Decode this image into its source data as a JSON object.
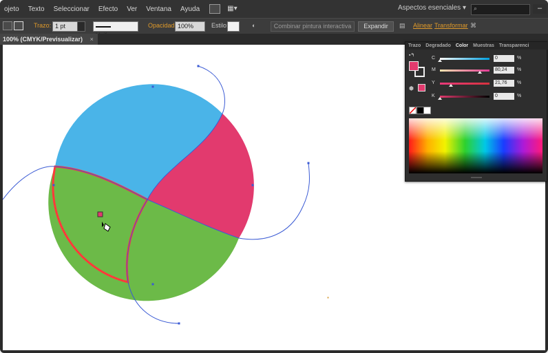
{
  "menubar": {
    "items": [
      "Objeto",
      "Texto",
      "Seleccionar",
      "Efecto",
      "Ver",
      "Ventana",
      "Ayuda"
    ],
    "visible_items": [
      "ojeto",
      "Texto",
      "Seleccionar",
      "Efecto",
      "Ver",
      "Ventana",
      "Ayuda"
    ],
    "arrange_label": "▦▾",
    "workspace": "Aspectos esenciales  ▾",
    "minimize": "–"
  },
  "control": {
    "stroke_label": "Trazo:",
    "stroke_value": "1 pt",
    "profile_label": "Uniforme",
    "opacity_label": "Opacidad:",
    "opacity_value": "100%",
    "style_label": "Estilo:",
    "live_paint_button": "Combinar pintura interactiva",
    "expand_button": "Expandir",
    "align_link": "Alinear",
    "transform_link": "Transformar"
  },
  "document": {
    "tab_title": "100% (CMYK/Previsualizar)",
    "tab_close": "×"
  },
  "color_panel": {
    "tabs": [
      "Trazo",
      "Degradado",
      "Color",
      "Muestras",
      "Transparenci"
    ],
    "active_tab": "Color",
    "channels": [
      {
        "label": "C",
        "value": "0",
        "fraction": 0.0,
        "gradient": [
          "#ffffff",
          "#00a0e0"
        ]
      },
      {
        "label": "M",
        "value": "80,24",
        "fraction": 0.8024,
        "gradient": [
          "#f8e6b0",
          "#e23c96"
        ]
      },
      {
        "label": "Y",
        "value": "21,76",
        "fraction": 0.2176,
        "gradient": [
          "#e83a7a",
          "#d8323e"
        ]
      },
      {
        "label": "K",
        "value": "0",
        "fraction": 0.0,
        "gradient": [
          "#e23a6e",
          "#000000"
        ]
      }
    ],
    "percent_sign": "%"
  },
  "artwork": {
    "colors": {
      "blue": "#4ab4e8",
      "pink": "#e23a6e",
      "green": "#6cba48",
      "selected_stroke": "#ff3a3a",
      "path": "#3a5ad4"
    }
  }
}
